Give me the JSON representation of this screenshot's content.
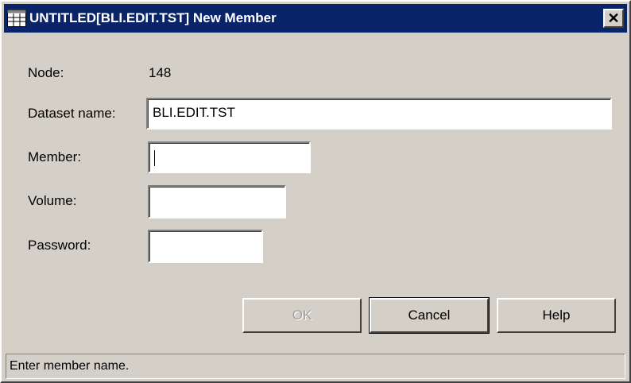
{
  "window": {
    "title": "UNTITLED[BLI.EDIT.TST] New Member",
    "close_label": "✕"
  },
  "form": {
    "node_label": "Node:",
    "node_value": "148",
    "dataset_label": "Dataset name:",
    "dataset_value": "BLI.EDIT.TST",
    "member_label": "Member:",
    "member_value": "",
    "volume_label": "Volume:",
    "volume_value": "",
    "password_label": "Password:",
    "password_value": ""
  },
  "buttons": {
    "ok_label": "OK",
    "cancel_label": "Cancel",
    "help_label": "Help"
  },
  "status": {
    "text": "Enter member name."
  },
  "colors": {
    "titlebar": "#0a246a",
    "face": "#d4d0c8"
  },
  "icons": {
    "app": "app-grid-icon",
    "close": "close-icon"
  }
}
